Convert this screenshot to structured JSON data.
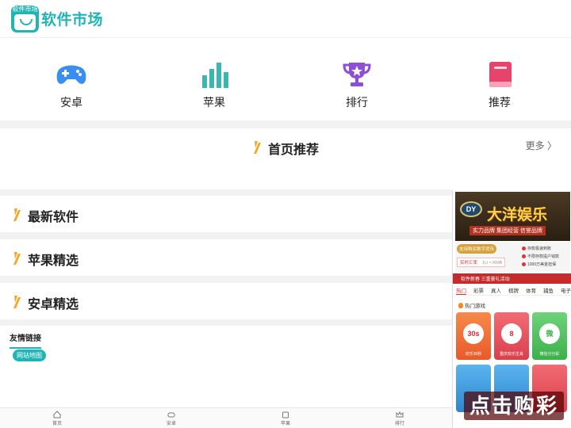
{
  "header": {
    "logo_text": "软件市场",
    "title": "软件市场"
  },
  "nav": [
    {
      "label": "安卓",
      "icon": "gamepad-icon"
    },
    {
      "label": "苹果",
      "icon": "bar-chart-icon"
    },
    {
      "label": "排行",
      "icon": "trophy-icon"
    },
    {
      "label": "推荐",
      "icon": "book-icon"
    }
  ],
  "featured": {
    "title": "首页推荐",
    "more": "更多 〉"
  },
  "sections": [
    {
      "title": "最新软件"
    },
    {
      "title": "苹果精选"
    },
    {
      "title": "安卓精选"
    }
  ],
  "links": {
    "title": "友情链接",
    "tag": "网站地图"
  },
  "bottom_nav": [
    {
      "label": "首页",
      "icon": "home-icon"
    },
    {
      "label": "安卓",
      "icon": "gamepad-icon"
    },
    {
      "label": "苹果",
      "icon": "bag-icon"
    },
    {
      "label": "排行",
      "icon": "crown-icon"
    }
  ],
  "ad": {
    "logo": "DY",
    "brand": "大洋娱乐",
    "slogan": "实力品牌  集团经营  信誉品牌",
    "pill": "支持购买数字货币",
    "rate_label": "实时汇率",
    "rate_value": "1U ≈ RMB",
    "features": [
      "存款极速到账",
      "不限存款提户钱款",
      "1000万美金担保"
    ],
    "bar_text": "软件新春 三重豪礼活动",
    "tabs": [
      "热门",
      "彩票",
      "真人",
      "棋牌",
      "体育",
      "捕鱼",
      "电子"
    ],
    "hot_label": "热门游戏",
    "games": [
      {
        "name": "欢乐30秒",
        "badge": "30s",
        "color": "#f06a3a"
      },
      {
        "name": "重庆欢乐生肖",
        "badge": "8",
        "color": "#e94f5c"
      },
      {
        "name": "微信分分彩",
        "badge": "微",
        "color": "#4cc45a"
      }
    ],
    "cta": "点击购彩"
  },
  "colors": {
    "accent": "#21b4b4",
    "slash": "#f5a623"
  }
}
